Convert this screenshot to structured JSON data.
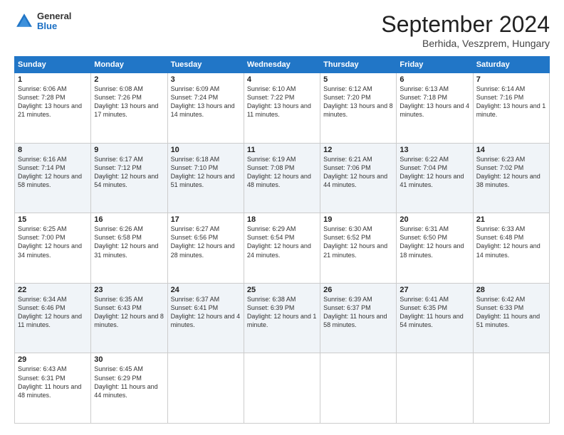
{
  "header": {
    "logo": {
      "general": "General",
      "blue": "Blue"
    },
    "month": "September 2024",
    "location": "Berhida, Veszprem, Hungary"
  },
  "days_of_week": [
    "Sunday",
    "Monday",
    "Tuesday",
    "Wednesday",
    "Thursday",
    "Friday",
    "Saturday"
  ],
  "weeks": [
    [
      {
        "day": "1",
        "info": "Sunrise: 6:06 AM\nSunset: 7:28 PM\nDaylight: 13 hours and 21 minutes."
      },
      {
        "day": "2",
        "info": "Sunrise: 6:08 AM\nSunset: 7:26 PM\nDaylight: 13 hours and 17 minutes."
      },
      {
        "day": "3",
        "info": "Sunrise: 6:09 AM\nSunset: 7:24 PM\nDaylight: 13 hours and 14 minutes."
      },
      {
        "day": "4",
        "info": "Sunrise: 6:10 AM\nSunset: 7:22 PM\nDaylight: 13 hours and 11 minutes."
      },
      {
        "day": "5",
        "info": "Sunrise: 6:12 AM\nSunset: 7:20 PM\nDaylight: 13 hours and 8 minutes."
      },
      {
        "day": "6",
        "info": "Sunrise: 6:13 AM\nSunset: 7:18 PM\nDaylight: 13 hours and 4 minutes."
      },
      {
        "day": "7",
        "info": "Sunrise: 6:14 AM\nSunset: 7:16 PM\nDaylight: 13 hours and 1 minute."
      }
    ],
    [
      {
        "day": "8",
        "info": "Sunrise: 6:16 AM\nSunset: 7:14 PM\nDaylight: 12 hours and 58 minutes."
      },
      {
        "day": "9",
        "info": "Sunrise: 6:17 AM\nSunset: 7:12 PM\nDaylight: 12 hours and 54 minutes."
      },
      {
        "day": "10",
        "info": "Sunrise: 6:18 AM\nSunset: 7:10 PM\nDaylight: 12 hours and 51 minutes."
      },
      {
        "day": "11",
        "info": "Sunrise: 6:19 AM\nSunset: 7:08 PM\nDaylight: 12 hours and 48 minutes."
      },
      {
        "day": "12",
        "info": "Sunrise: 6:21 AM\nSunset: 7:06 PM\nDaylight: 12 hours and 44 minutes."
      },
      {
        "day": "13",
        "info": "Sunrise: 6:22 AM\nSunset: 7:04 PM\nDaylight: 12 hours and 41 minutes."
      },
      {
        "day": "14",
        "info": "Sunrise: 6:23 AM\nSunset: 7:02 PM\nDaylight: 12 hours and 38 minutes."
      }
    ],
    [
      {
        "day": "15",
        "info": "Sunrise: 6:25 AM\nSunset: 7:00 PM\nDaylight: 12 hours and 34 minutes."
      },
      {
        "day": "16",
        "info": "Sunrise: 6:26 AM\nSunset: 6:58 PM\nDaylight: 12 hours and 31 minutes."
      },
      {
        "day": "17",
        "info": "Sunrise: 6:27 AM\nSunset: 6:56 PM\nDaylight: 12 hours and 28 minutes."
      },
      {
        "day": "18",
        "info": "Sunrise: 6:29 AM\nSunset: 6:54 PM\nDaylight: 12 hours and 24 minutes."
      },
      {
        "day": "19",
        "info": "Sunrise: 6:30 AM\nSunset: 6:52 PM\nDaylight: 12 hours and 21 minutes."
      },
      {
        "day": "20",
        "info": "Sunrise: 6:31 AM\nSunset: 6:50 PM\nDaylight: 12 hours and 18 minutes."
      },
      {
        "day": "21",
        "info": "Sunrise: 6:33 AM\nSunset: 6:48 PM\nDaylight: 12 hours and 14 minutes."
      }
    ],
    [
      {
        "day": "22",
        "info": "Sunrise: 6:34 AM\nSunset: 6:46 PM\nDaylight: 12 hours and 11 minutes."
      },
      {
        "day": "23",
        "info": "Sunrise: 6:35 AM\nSunset: 6:43 PM\nDaylight: 12 hours and 8 minutes."
      },
      {
        "day": "24",
        "info": "Sunrise: 6:37 AM\nSunset: 6:41 PM\nDaylight: 12 hours and 4 minutes."
      },
      {
        "day": "25",
        "info": "Sunrise: 6:38 AM\nSunset: 6:39 PM\nDaylight: 12 hours and 1 minute."
      },
      {
        "day": "26",
        "info": "Sunrise: 6:39 AM\nSunset: 6:37 PM\nDaylight: 11 hours and 58 minutes."
      },
      {
        "day": "27",
        "info": "Sunrise: 6:41 AM\nSunset: 6:35 PM\nDaylight: 11 hours and 54 minutes."
      },
      {
        "day": "28",
        "info": "Sunrise: 6:42 AM\nSunset: 6:33 PM\nDaylight: 11 hours and 51 minutes."
      }
    ],
    [
      {
        "day": "29",
        "info": "Sunrise: 6:43 AM\nSunset: 6:31 PM\nDaylight: 11 hours and 48 minutes."
      },
      {
        "day": "30",
        "info": "Sunrise: 6:45 AM\nSunset: 6:29 PM\nDaylight: 11 hours and 44 minutes."
      },
      {
        "day": "",
        "info": ""
      },
      {
        "day": "",
        "info": ""
      },
      {
        "day": "",
        "info": ""
      },
      {
        "day": "",
        "info": ""
      },
      {
        "day": "",
        "info": ""
      }
    ]
  ]
}
